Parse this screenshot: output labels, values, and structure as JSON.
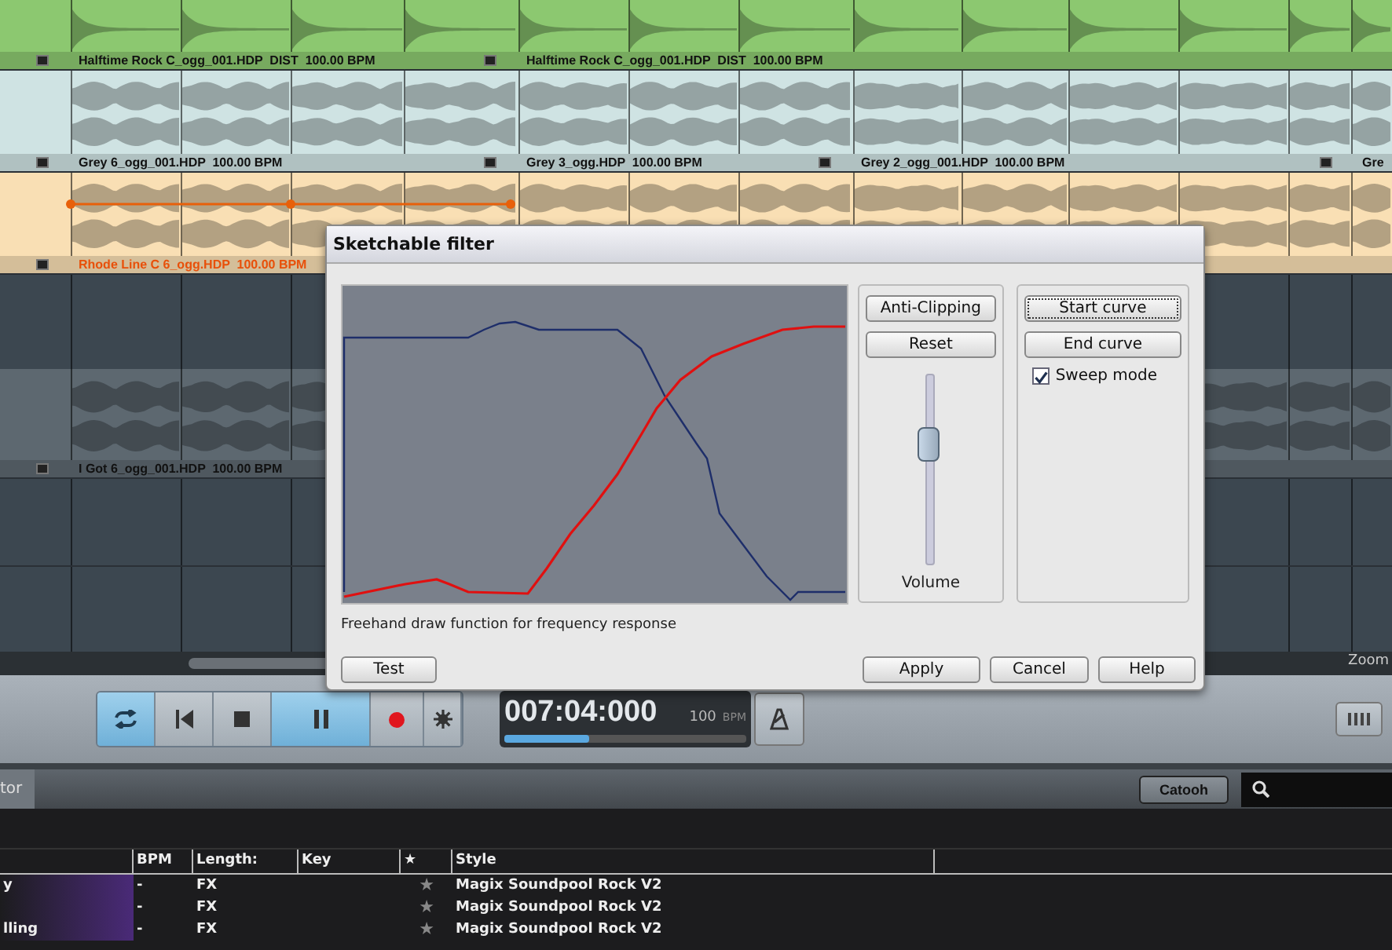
{
  "tracks": [
    {
      "color": "#8cc870",
      "selected": false,
      "clips": [
        "Halftime Rock C_ogg_001.HDP  DIST  100.00 BPM",
        "Halftime Rock C_ogg_001.HDP  DIST  100.00 BPM"
      ]
    },
    {
      "color": "#cfe3e3",
      "selected": false,
      "clips": [
        "Grey 6_ogg_001.HDP  100.00 BPM",
        "Grey 3_ogg.HDP  100.00 BPM",
        "Grey 2_ogg_001.HDP  100.00 BPM",
        "Gre"
      ]
    },
    {
      "color": "#f9dfb4",
      "selected": true,
      "clips": [
        "Rhode Line C 6_ogg.HDP  100.00 BPM"
      ]
    },
    {
      "color": "#5d6870",
      "selected": false,
      "clips": [
        "I Got 6_ogg_001.HDP  100.00 BPM"
      ]
    }
  ],
  "zoom_label": "Zoom",
  "transport": {
    "buttons": [
      {
        "kind": "loop",
        "active": true
      },
      {
        "kind": "previous",
        "active": false
      },
      {
        "kind": "stop",
        "active": false
      },
      {
        "kind": "pause",
        "active": true
      },
      {
        "kind": "record",
        "active": false
      },
      {
        "kind": "settings",
        "active": false
      }
    ],
    "time": "007:04:000",
    "tempo": "100",
    "tempo_unit": "BPM",
    "level": 0.35
  },
  "dialog": {
    "title": "Sketchable filter",
    "anti_clipping": "Anti-Clipping",
    "reset": "Reset",
    "volume_label": "Volume",
    "volume": {
      "level": 0.63
    },
    "start_curve": "Start curve",
    "end_curve": "End curve",
    "sweep": {
      "label": "Sweep mode",
      "checked": true
    },
    "description": "Freehand draw function for frequency response",
    "test": "Test",
    "apply": "Apply",
    "cancel": "Cancel",
    "help": "Help"
  },
  "browser": {
    "tab": "tor",
    "catooh": "Catooh",
    "columns": [
      "BPM",
      "Length:",
      "Key",
      "★",
      "Style"
    ],
    "rows": [
      {
        "column_1": "y",
        "bpm": "-",
        "length": "FX",
        "rating": "★",
        "style": "Magix Soundpool  Rock V2"
      },
      {
        "bpm": "-",
        "length": "FX",
        "rating": "★",
        "style": "Magix Soundpool  Rock V2"
      },
      {
        "column_1": "lling",
        "bpm": "-",
        "length": "FX",
        "rating": "★",
        "style": "Magix Soundpool  Rock V2"
      }
    ]
  }
}
